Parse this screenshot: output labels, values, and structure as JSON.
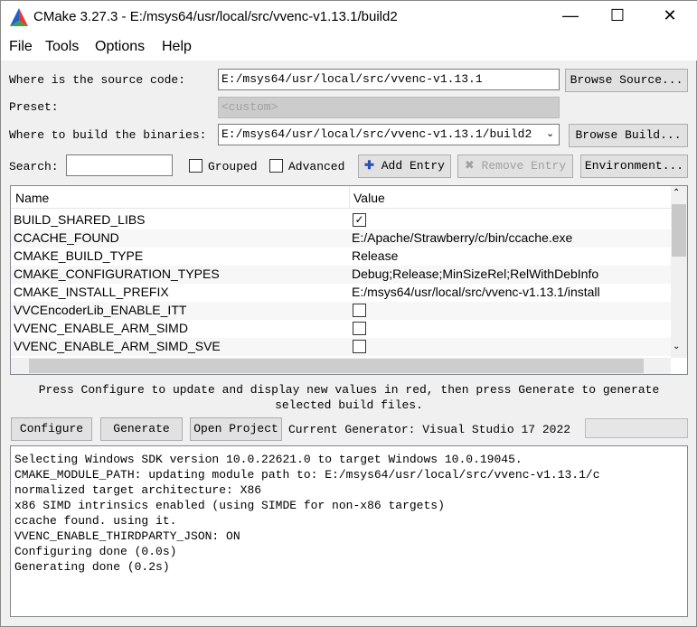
{
  "window": {
    "title": "CMake 3.27.3 - E:/msys64/usr/local/src/vvenc-v1.13.1/build2",
    "minimize": "—",
    "maximize": "☐",
    "close": "✕"
  },
  "menu": [
    "File",
    "Tools",
    "Options",
    "Help"
  ],
  "source": {
    "label": "Where is the source code:",
    "value": "E:/msys64/usr/local/src/vvenc-v1.13.1",
    "button": "Browse Source..."
  },
  "preset": {
    "label": "Preset:",
    "value": "<custom>"
  },
  "build": {
    "label": "Where to build the binaries:",
    "value": "E:/msys64/usr/local/src/vvenc-v1.13.1/build2",
    "button": "Browse Build..."
  },
  "search": {
    "label": "Search:",
    "value": ""
  },
  "grouped": {
    "label": "Grouped",
    "checked": false
  },
  "advanced": {
    "label": "Advanced",
    "checked": false
  },
  "add_entry": "Add Entry",
  "remove_entry": "Remove Entry",
  "environment": "Environment...",
  "table": {
    "headers": [
      "Name",
      "Value"
    ],
    "rows": [
      {
        "name": "BUILD_SHARED_LIBS",
        "value": "",
        "checkbox": true,
        "checked": true
      },
      {
        "name": "CCACHE_FOUND",
        "value": "E:/Apache/Strawberry/c/bin/ccache.exe"
      },
      {
        "name": "CMAKE_BUILD_TYPE",
        "value": "Release"
      },
      {
        "name": "CMAKE_CONFIGURATION_TYPES",
        "value": "Debug;Release;MinSizeRel;RelWithDebInfo"
      },
      {
        "name": "CMAKE_INSTALL_PREFIX",
        "value": "E:/msys64/usr/local/src/vvenc-v1.13.1/install"
      },
      {
        "name": "VVCEncoderLib_ENABLE_ITT",
        "value": "",
        "checkbox": true,
        "checked": false
      },
      {
        "name": "VVENC_ENABLE_ARM_SIMD",
        "value": "",
        "checkbox": true,
        "checked": false
      },
      {
        "name": "VVENC_ENABLE_ARM_SIMD_SVE",
        "value": "",
        "checkbox": true,
        "checked": false
      }
    ]
  },
  "hint": "Press Configure to update and display new values in red, then press Generate to generate selected build files.",
  "configure": "Configure",
  "generate": "Generate",
  "open_project": "Open Project",
  "generator": "Current Generator: Visual Studio 17 2022",
  "output": "Selecting Windows SDK version 10.0.22621.0 to target Windows 10.0.19045.\nCMAKE_MODULE_PATH: updating module path to: E:/msys64/usr/local/src/vvenc-v1.13.1/c\nnormalized target architecture: X86\nx86 SIMD intrinsics enabled (using SIMDE for non-x86 targets)\nccache found. using it.\nVVENC_ENABLE_THIRDPARTY_JSON: ON\nConfiguring done (0.0s)\nGenerating done (0.2s)"
}
